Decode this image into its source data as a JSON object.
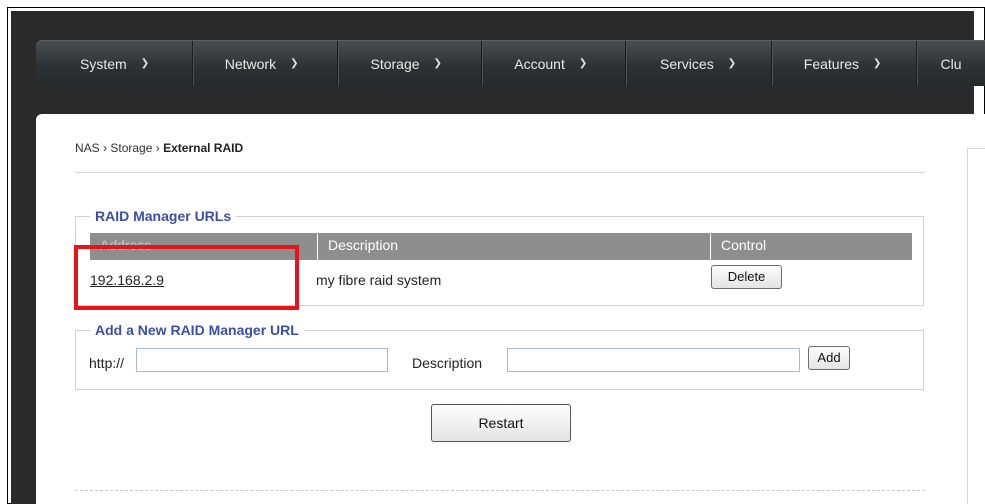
{
  "nav": {
    "items": [
      {
        "label": "System"
      },
      {
        "label": "Network"
      },
      {
        "label": "Storage"
      },
      {
        "label": "Account"
      },
      {
        "label": "Services"
      },
      {
        "label": "Features"
      },
      {
        "label": "Clu"
      }
    ]
  },
  "breadcrumb": {
    "root": "NAS",
    "section": "Storage",
    "current": "External RAID",
    "separator": "›"
  },
  "raid_urls": {
    "legend": "RAID Manager URLs",
    "columns": [
      "Address",
      "Description",
      "Control"
    ],
    "rows": [
      {
        "address": "192.168.2.9",
        "description": "my fibre raid system",
        "action": "Delete"
      }
    ]
  },
  "add_form": {
    "legend": "Add a New RAID Manager URL",
    "http_label": "http://",
    "http_value": "",
    "description_label": "Description",
    "description_value": "",
    "add_label": "Add"
  },
  "restart_label": "Restart",
  "colors": {
    "legend": "#3b4fa6",
    "highlight": "#e8141b",
    "table_header": "#8e8e8e"
  }
}
